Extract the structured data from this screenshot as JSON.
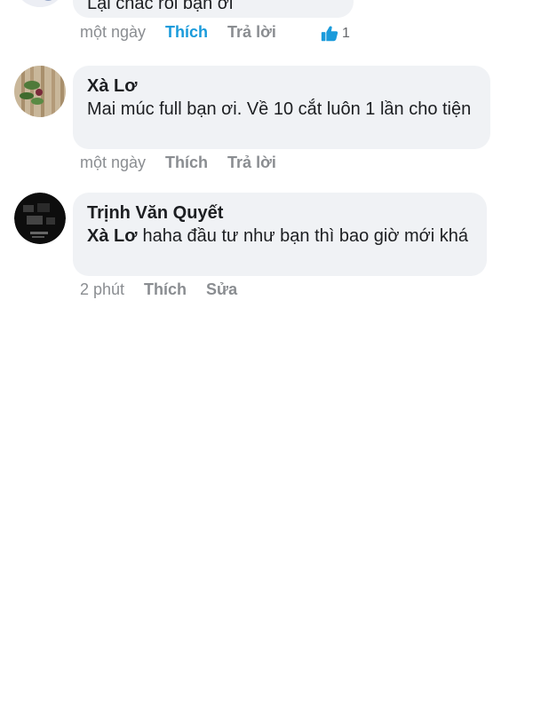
{
  "top_comment": {
    "text": "Lại chắc rồi bạn ơi",
    "time": "một ngày",
    "like_label": "Thích",
    "reply_label": "Trả lời",
    "reaction_count": "1",
    "like_active_color": "#1a9bdb"
  },
  "comments": [
    {
      "author": "Xà Lơ",
      "text": "Mai múc full bạn ơi. Về 10 cắt luôn 1 lần cho tiện",
      "time": "một ngày",
      "like_label": "Thích",
      "reply_label": "Trả lời"
    },
    {
      "author": "Trịnh Văn Quyết",
      "mention": "Xà Lơ",
      "text": "haha đầu tư như bạn thì bao giờ mới khá",
      "time": "2 phút",
      "like_label": "Thích",
      "edit_label": "Sửa"
    }
  ],
  "colors": {
    "bubble_bg": "#f0f2f5",
    "meta_text": "#8a8d91",
    "accent": "#1a9bdb"
  }
}
